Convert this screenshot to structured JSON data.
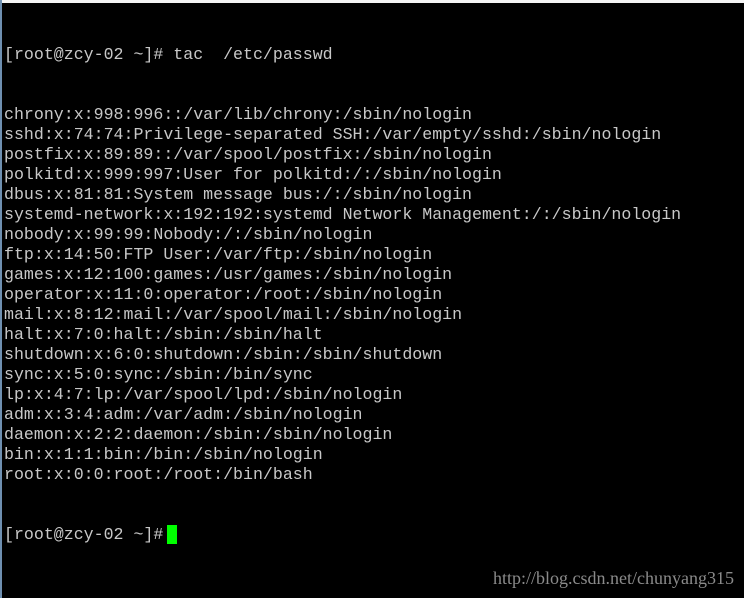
{
  "terminal": {
    "command_line": "[root@zcy-02 ~]# tac  /etc/passwd",
    "output": [
      "chrony:x:998:996::/var/lib/chrony:/sbin/nologin",
      "sshd:x:74:74:Privilege-separated SSH:/var/empty/sshd:/sbin/nologin",
      "postfix:x:89:89::/var/spool/postfix:/sbin/nologin",
      "polkitd:x:999:997:User for polkitd:/:/sbin/nologin",
      "dbus:x:81:81:System message bus:/:/sbin/nologin",
      "systemd-network:x:192:192:systemd Network Management:/:/sbin/nologin",
      "nobody:x:99:99:Nobody:/:/sbin/nologin",
      "ftp:x:14:50:FTP User:/var/ftp:/sbin/nologin",
      "games:x:12:100:games:/usr/games:/sbin/nologin",
      "operator:x:11:0:operator:/root:/sbin/nologin",
      "mail:x:8:12:mail:/var/spool/mail:/sbin/nologin",
      "halt:x:7:0:halt:/sbin:/sbin/halt",
      "shutdown:x:6:0:shutdown:/sbin:/sbin/shutdown",
      "sync:x:5:0:sync:/sbin:/bin/sync",
      "lp:x:4:7:lp:/var/spool/lpd:/sbin/nologin",
      "adm:x:3:4:adm:/var/adm:/sbin/nologin",
      "daemon:x:2:2:daemon:/sbin:/sbin/nologin",
      "bin:x:1:1:bin:/bin:/sbin/nologin",
      "root:x:0:0:root:/root:/bin/bash"
    ],
    "prompt": "[root@zcy-02 ~]#",
    "cursor_color": "#00ff00",
    "text_color": "#c8c8c8",
    "background_color": "#000000"
  },
  "watermark": "http://blog.csdn.net/chunyang315"
}
